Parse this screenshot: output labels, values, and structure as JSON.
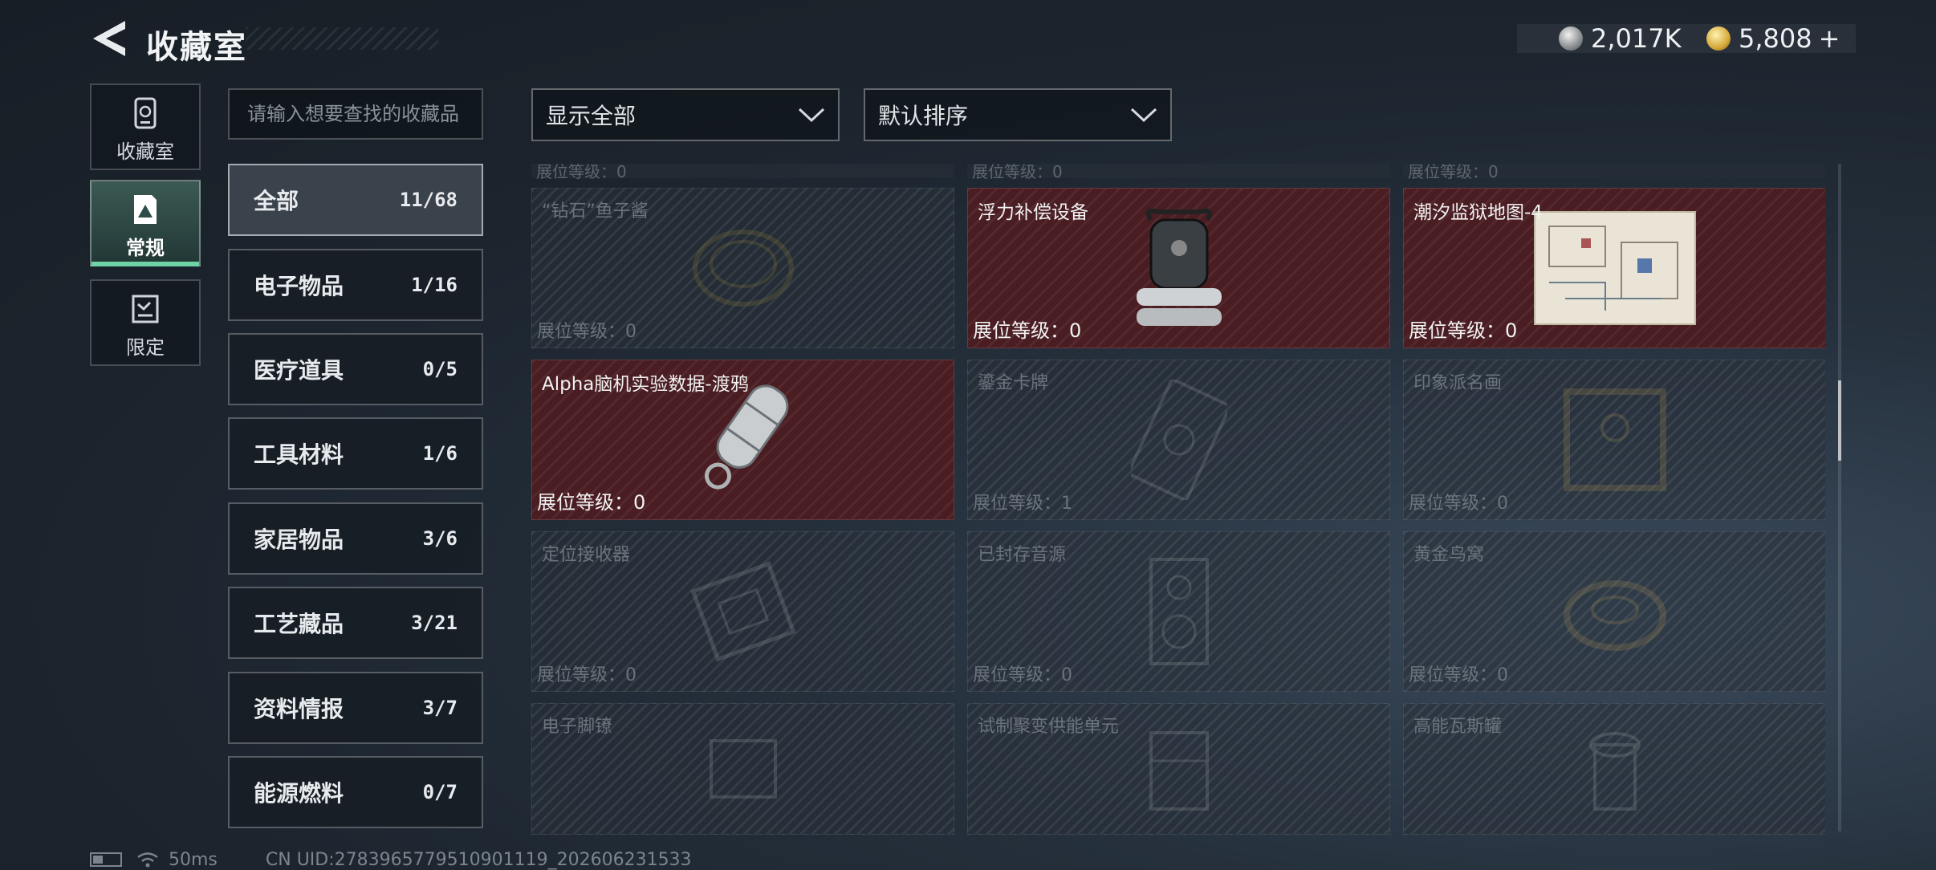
{
  "header": {
    "title": "收藏室",
    "currency_silver": "2,017K",
    "currency_gold": "5,808",
    "add_label": "+"
  },
  "nav": {
    "items": [
      {
        "label": "收藏室",
        "icon": "collection-room-icon"
      },
      {
        "label": "常规",
        "icon": "regular-icon",
        "active": true
      },
      {
        "label": "限定",
        "icon": "limited-icon"
      }
    ]
  },
  "search": {
    "placeholder": "请输入想要查找的收藏品"
  },
  "filters": {
    "show": "显示全部",
    "sort": "默认排序"
  },
  "categories": [
    {
      "name": "全部",
      "count": "11/68",
      "active": true
    },
    {
      "name": "电子物品",
      "count": "1/16"
    },
    {
      "name": "医疗道具",
      "count": "0/5"
    },
    {
      "name": "工具材料",
      "count": "1/6"
    },
    {
      "name": "家居物品",
      "count": "3/6"
    },
    {
      "name": "工艺藏品",
      "count": "3/21"
    },
    {
      "name": "资料情报",
      "count": "3/7"
    },
    {
      "name": "能源燃料",
      "count": "0/7"
    }
  ],
  "grid": {
    "partial_level_label": "展位等级：0",
    "items": [
      {
        "name": "“钻石”鱼子酱",
        "level": "展位等级：0",
        "owned": false,
        "icon": "caviar-tin-icon"
      },
      {
        "name": "浮力补偿设备",
        "level": "展位等级：0",
        "owned": true,
        "icon": "buoyancy-device-icon"
      },
      {
        "name": "潮汐监狱地图-4",
        "level": "展位等级：0",
        "owned": true,
        "icon": "prison-map-icon"
      },
      {
        "name": "Alpha脑机实验数据-渡鸦",
        "level": "展位等级：0",
        "owned": true,
        "icon": "data-capsule-icon"
      },
      {
        "name": "鎏金卡牌",
        "level": "展位等级：1",
        "owned": false,
        "icon": "gilded-card-icon"
      },
      {
        "name": "印象派名画",
        "level": "展位等级：0",
        "owned": false,
        "icon": "painting-icon"
      },
      {
        "name": "定位接收器",
        "level": "展位等级：0",
        "owned": false,
        "icon": "locator-receiver-icon"
      },
      {
        "name": "已封存音源",
        "level": "展位等级：0",
        "owned": false,
        "icon": "sealed-audio-icon"
      },
      {
        "name": "黄金鸟窝",
        "level": "展位等级：0",
        "owned": false,
        "icon": "golden-nest-icon"
      },
      {
        "name": "电子脚镣",
        "level": "",
        "owned": false,
        "icon": "electronic-shackle-icon"
      },
      {
        "name": "试制聚变供能单元",
        "level": "",
        "owned": false,
        "icon": "fusion-unit-icon"
      },
      {
        "name": "高能瓦斯罐",
        "level": "",
        "owned": false,
        "icon": "gas-canister-icon"
      }
    ]
  },
  "status": {
    "ping": "50ms",
    "uid": "CN UID:2783965779510901119_202606231533"
  }
}
